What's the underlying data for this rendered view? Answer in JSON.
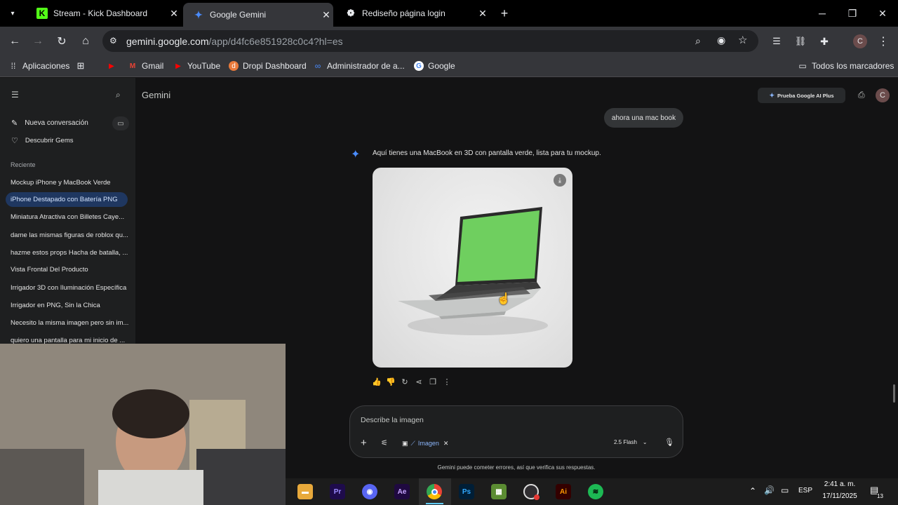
{
  "browser": {
    "tabs": [
      {
        "title": "Stream - Kick Dashboard",
        "icon": "kick-icon",
        "active": false
      },
      {
        "title": "Google Gemini",
        "icon": "gemini-icon",
        "active": true
      },
      {
        "title": "Rediseño página login",
        "icon": "openai-icon",
        "active": false
      }
    ],
    "url_host": "gemini.google.com",
    "url_path": "/app/d4fc6e851928c0c4?hl=es",
    "bookmarks": [
      {
        "label": "Aplicaciones",
        "icon": "apps-grid-icon"
      },
      {
        "label": "Gmail",
        "icon": "gmail-icon"
      },
      {
        "label": "YouTube",
        "icon": "youtube-icon"
      },
      {
        "label": "Dropi Dashboard",
        "icon": "dropi-icon"
      },
      {
        "label": "Administrador de a...",
        "icon": "meta-icon"
      },
      {
        "label": "Google",
        "icon": "google-icon"
      }
    ],
    "all_bookmarks": "Todos los marcadores",
    "profile_initial": "C"
  },
  "gemini": {
    "title": "Gemini",
    "new_chat": "Nueva conversación",
    "discover_gems": "Descubrir Gems",
    "recent_label": "Reciente",
    "recent": [
      "Mockup iPhone y MacBook Verde",
      "iPhone Destapado con Batería PNG",
      "Miniatura Atractiva con Billetes Caye...",
      "dame las mismas figuras de roblox qu...",
      "hazme estos props Hacha de batalla, ...",
      "Vista Frontal Del Producto",
      "Irrigador 3D con Iluminación Específica",
      "Irrigador en PNG, Sin la Chica",
      "Necesito la misma imagen pero sin im...",
      "quiero una pantalla para mi inicio de ..."
    ],
    "upgrade_button": "Prueba Google AI Plus",
    "user_message": "ahora una mac book",
    "response_text": "Aquí tienes una MacBook en 3D con pantalla verde, lista para tu mockup.",
    "input_placeholder": "Describe la imagen",
    "chip_label": "Imagen",
    "model_label": "2.5 Flash",
    "disclaimer": "Gemini puede cometer errores, así que verifica sus respuestas.",
    "colors": {
      "accent_blue": "#4a8cff",
      "selected_bg": "#1f3760",
      "screen_green": "#6fcf5f"
    }
  },
  "taskbar": {
    "apps": [
      "file-explorer",
      "premiere-pro",
      "discord",
      "after-effects",
      "chrome",
      "photoshop",
      "minecraft",
      "obs",
      "illustrator",
      "spotify"
    ],
    "app_labels": {
      "premiere": "Pr",
      "aftereffects": "Ae",
      "photoshop": "Ps",
      "illustrator": "Ai"
    },
    "language": "ESP",
    "time": "2:41 a. m.",
    "date": "17/11/2025",
    "notifications": "13"
  }
}
